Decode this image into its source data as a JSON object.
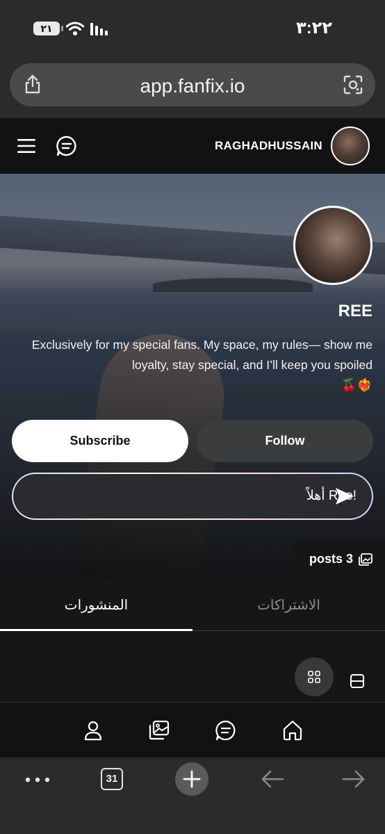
{
  "status_bar": {
    "battery": "٢١",
    "time": "٣:٢٢"
  },
  "browser": {
    "url": "app.fanfix.io",
    "tab_count": "31"
  },
  "header": {
    "username": "RAGHADHUSSAIN"
  },
  "profile": {
    "display_name": "REE",
    "bio": "Exclusively for my special fans. My space, my rules— show me loyalty, stay special, and I’ll keep you spoiled",
    "bio_emoji": "🍒❤️‍🔥"
  },
  "actions": {
    "subscribe_label": "Subscribe",
    "follow_label": "Follow"
  },
  "message": {
    "text": "أهلاً Ree!"
  },
  "posts_badge": {
    "label": "posts 3"
  },
  "tabs": [
    {
      "label": "المنشورات",
      "active": true
    },
    {
      "label": "الاشتراكات",
      "active": false
    }
  ],
  "icons": {
    "header_left": [
      "menu-icon",
      "chat-icon"
    ],
    "site_nav": [
      "home-icon",
      "chat-icon",
      "gallery-icon",
      "profile-icon"
    ],
    "browser": [
      "share-icon",
      "lens-icon",
      "more-icon",
      "new-tab-icon",
      "back-icon",
      "forward-icon"
    ]
  },
  "colors": {
    "accent_white": "#ffffff",
    "follow_bg": "#3a3c3e",
    "page_bg": "#161617",
    "header_bg": "#121212"
  }
}
